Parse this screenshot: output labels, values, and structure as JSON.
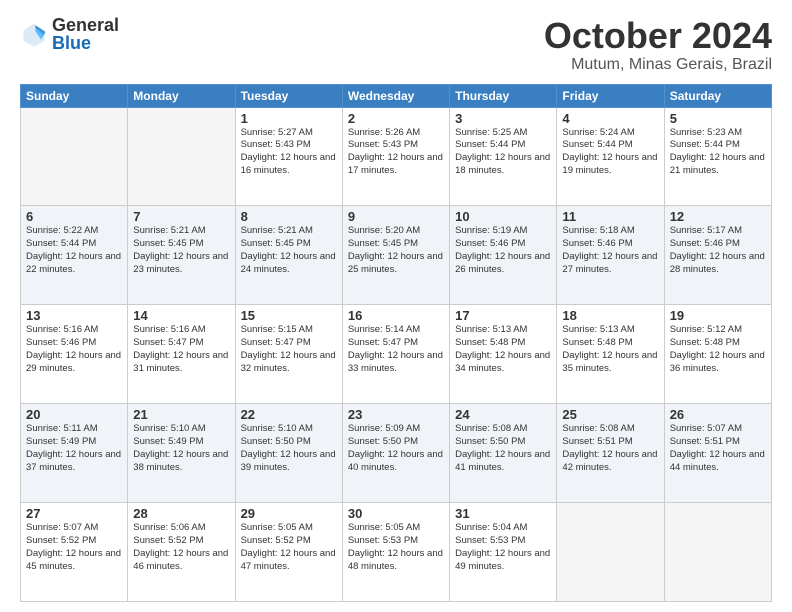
{
  "header": {
    "logo_general": "General",
    "logo_blue": "Blue",
    "month": "October 2024",
    "location": "Mutum, Minas Gerais, Brazil"
  },
  "weekdays": [
    "Sunday",
    "Monday",
    "Tuesday",
    "Wednesday",
    "Thursday",
    "Friday",
    "Saturday"
  ],
  "weeks": [
    [
      {
        "day": "",
        "info": ""
      },
      {
        "day": "",
        "info": ""
      },
      {
        "day": "1",
        "info": "Sunrise: 5:27 AM\nSunset: 5:43 PM\nDaylight: 12 hours\nand 16 minutes."
      },
      {
        "day": "2",
        "info": "Sunrise: 5:26 AM\nSunset: 5:43 PM\nDaylight: 12 hours\nand 17 minutes."
      },
      {
        "day": "3",
        "info": "Sunrise: 5:25 AM\nSunset: 5:44 PM\nDaylight: 12 hours\nand 18 minutes."
      },
      {
        "day": "4",
        "info": "Sunrise: 5:24 AM\nSunset: 5:44 PM\nDaylight: 12 hours\nand 19 minutes."
      },
      {
        "day": "5",
        "info": "Sunrise: 5:23 AM\nSunset: 5:44 PM\nDaylight: 12 hours\nand 21 minutes."
      }
    ],
    [
      {
        "day": "6",
        "info": "Sunrise: 5:22 AM\nSunset: 5:44 PM\nDaylight: 12 hours\nand 22 minutes."
      },
      {
        "day": "7",
        "info": "Sunrise: 5:21 AM\nSunset: 5:45 PM\nDaylight: 12 hours\nand 23 minutes."
      },
      {
        "day": "8",
        "info": "Sunrise: 5:21 AM\nSunset: 5:45 PM\nDaylight: 12 hours\nand 24 minutes."
      },
      {
        "day": "9",
        "info": "Sunrise: 5:20 AM\nSunset: 5:45 PM\nDaylight: 12 hours\nand 25 minutes."
      },
      {
        "day": "10",
        "info": "Sunrise: 5:19 AM\nSunset: 5:46 PM\nDaylight: 12 hours\nand 26 minutes."
      },
      {
        "day": "11",
        "info": "Sunrise: 5:18 AM\nSunset: 5:46 PM\nDaylight: 12 hours\nand 27 minutes."
      },
      {
        "day": "12",
        "info": "Sunrise: 5:17 AM\nSunset: 5:46 PM\nDaylight: 12 hours\nand 28 minutes."
      }
    ],
    [
      {
        "day": "13",
        "info": "Sunrise: 5:16 AM\nSunset: 5:46 PM\nDaylight: 12 hours\nand 29 minutes."
      },
      {
        "day": "14",
        "info": "Sunrise: 5:16 AM\nSunset: 5:47 PM\nDaylight: 12 hours\nand 31 minutes."
      },
      {
        "day": "15",
        "info": "Sunrise: 5:15 AM\nSunset: 5:47 PM\nDaylight: 12 hours\nand 32 minutes."
      },
      {
        "day": "16",
        "info": "Sunrise: 5:14 AM\nSunset: 5:47 PM\nDaylight: 12 hours\nand 33 minutes."
      },
      {
        "day": "17",
        "info": "Sunrise: 5:13 AM\nSunset: 5:48 PM\nDaylight: 12 hours\nand 34 minutes."
      },
      {
        "day": "18",
        "info": "Sunrise: 5:13 AM\nSunset: 5:48 PM\nDaylight: 12 hours\nand 35 minutes."
      },
      {
        "day": "19",
        "info": "Sunrise: 5:12 AM\nSunset: 5:48 PM\nDaylight: 12 hours\nand 36 minutes."
      }
    ],
    [
      {
        "day": "20",
        "info": "Sunrise: 5:11 AM\nSunset: 5:49 PM\nDaylight: 12 hours\nand 37 minutes."
      },
      {
        "day": "21",
        "info": "Sunrise: 5:10 AM\nSunset: 5:49 PM\nDaylight: 12 hours\nand 38 minutes."
      },
      {
        "day": "22",
        "info": "Sunrise: 5:10 AM\nSunset: 5:50 PM\nDaylight: 12 hours\nand 39 minutes."
      },
      {
        "day": "23",
        "info": "Sunrise: 5:09 AM\nSunset: 5:50 PM\nDaylight: 12 hours\nand 40 minutes."
      },
      {
        "day": "24",
        "info": "Sunrise: 5:08 AM\nSunset: 5:50 PM\nDaylight: 12 hours\nand 41 minutes."
      },
      {
        "day": "25",
        "info": "Sunrise: 5:08 AM\nSunset: 5:51 PM\nDaylight: 12 hours\nand 42 minutes."
      },
      {
        "day": "26",
        "info": "Sunrise: 5:07 AM\nSunset: 5:51 PM\nDaylight: 12 hours\nand 44 minutes."
      }
    ],
    [
      {
        "day": "27",
        "info": "Sunrise: 5:07 AM\nSunset: 5:52 PM\nDaylight: 12 hours\nand 45 minutes."
      },
      {
        "day": "28",
        "info": "Sunrise: 5:06 AM\nSunset: 5:52 PM\nDaylight: 12 hours\nand 46 minutes."
      },
      {
        "day": "29",
        "info": "Sunrise: 5:05 AM\nSunset: 5:52 PM\nDaylight: 12 hours\nand 47 minutes."
      },
      {
        "day": "30",
        "info": "Sunrise: 5:05 AM\nSunset: 5:53 PM\nDaylight: 12 hours\nand 48 minutes."
      },
      {
        "day": "31",
        "info": "Sunrise: 5:04 AM\nSunset: 5:53 PM\nDaylight: 12 hours\nand 49 minutes."
      },
      {
        "day": "",
        "info": ""
      },
      {
        "day": "",
        "info": ""
      }
    ]
  ]
}
